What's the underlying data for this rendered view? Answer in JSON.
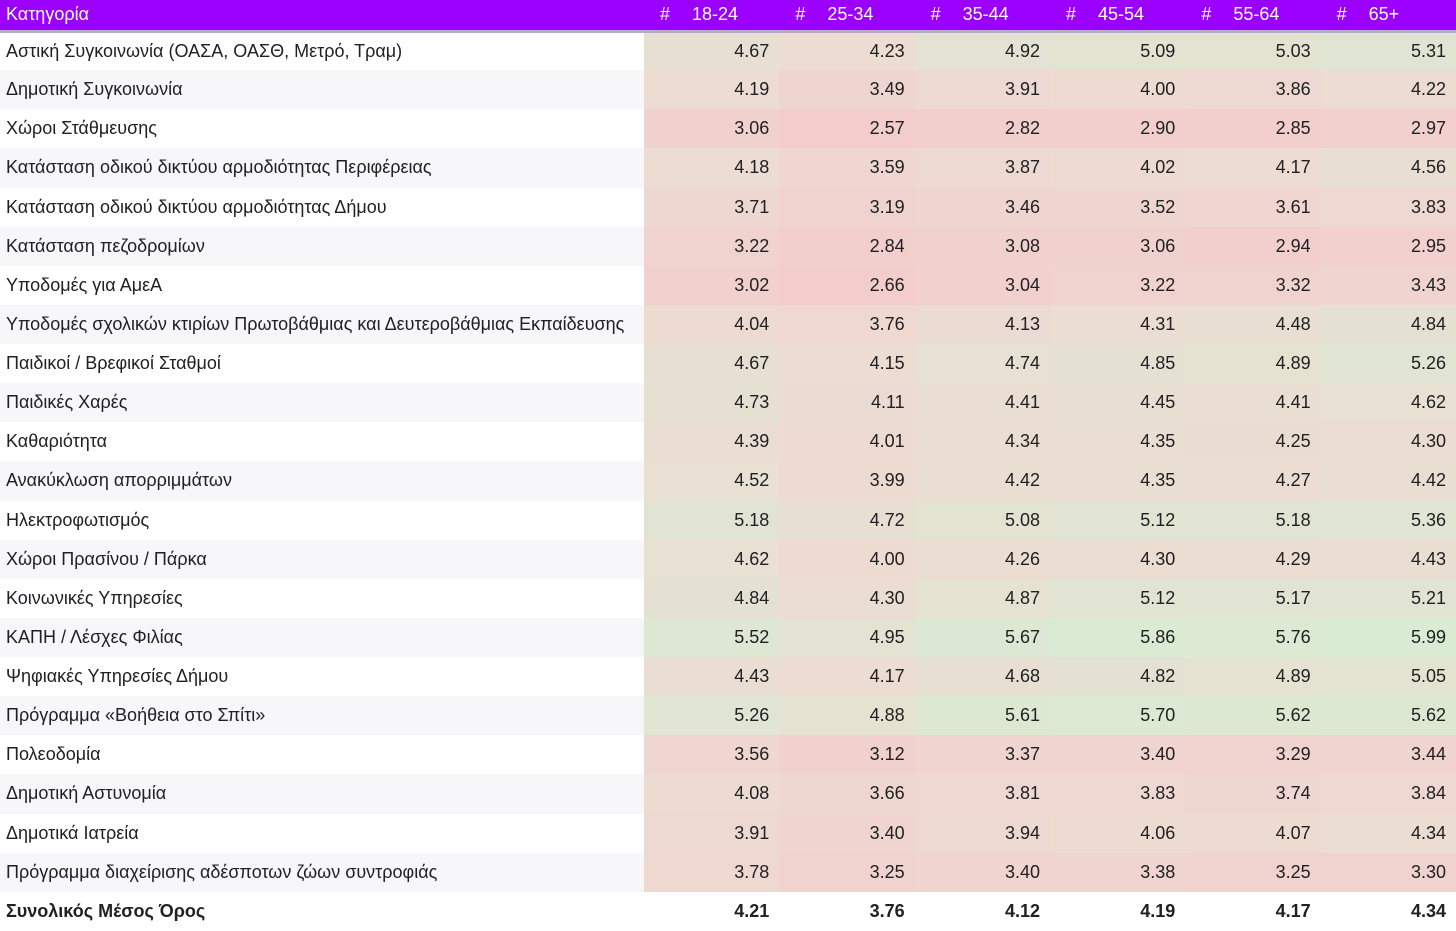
{
  "header": {
    "category_label": "Κατηγορία",
    "hash": "#",
    "age_groups": [
      "18-24",
      "25-34",
      "35-44",
      "45-54",
      "55-64",
      "65+"
    ]
  },
  "rows": [
    {
      "label": "Αστική Συγκοινωνία (ΟΑΣΑ, ΟΑΣΘ, Μετρό, Τραμ)",
      "values": [
        "4.67",
        "4.23",
        "4.92",
        "5.09",
        "5.03",
        "5.31"
      ]
    },
    {
      "label": "Δημοτική Συγκοινωνία",
      "values": [
        "4.19",
        "3.49",
        "3.91",
        "4.00",
        "3.86",
        "4.22"
      ]
    },
    {
      "label": "Χώροι Στάθμευσης",
      "values": [
        "3.06",
        "2.57",
        "2.82",
        "2.90",
        "2.85",
        "2.97"
      ]
    },
    {
      "label": "Κατάσταση οδικού δικτύου αρμοδιότητας Περιφέρειας",
      "values": [
        "4.18",
        "3.59",
        "3.87",
        "4.02",
        "4.17",
        "4.56"
      ]
    },
    {
      "label": "Κατάσταση οδικού δικτύου αρμοδιότητας Δήμου",
      "values": [
        "3.71",
        "3.19",
        "3.46",
        "3.52",
        "3.61",
        "3.83"
      ]
    },
    {
      "label": "Κατάσταση πεζοδρομίων",
      "values": [
        "3.22",
        "2.84",
        "3.08",
        "3.06",
        "2.94",
        "2.95"
      ]
    },
    {
      "label": "Υποδομές για ΑμεΑ",
      "values": [
        "3.02",
        "2.66",
        "3.04",
        "3.22",
        "3.32",
        "3.43"
      ]
    },
    {
      "label": "Υποδομές σχολικών κτιρίων Πρωτοβάθμιας και Δευτεροβάθμιας Εκπαίδευσης",
      "values": [
        "4.04",
        "3.76",
        "4.13",
        "4.31",
        "4.48",
        "4.84"
      ]
    },
    {
      "label": "Παιδικοί / Βρεφικοί Σταθμοί",
      "values": [
        "4.67",
        "4.15",
        "4.74",
        "4.85",
        "4.89",
        "5.26"
      ]
    },
    {
      "label": "Παιδικές Χαρές",
      "values": [
        "4.73",
        "4.11",
        "4.41",
        "4.45",
        "4.41",
        "4.62"
      ]
    },
    {
      "label": "Καθαριότητα",
      "values": [
        "4.39",
        "4.01",
        "4.34",
        "4.35",
        "4.25",
        "4.30"
      ]
    },
    {
      "label": "Ανακύκλωση απορριμμάτων",
      "values": [
        "4.52",
        "3.99",
        "4.42",
        "4.35",
        "4.27",
        "4.42"
      ]
    },
    {
      "label": "Ηλεκτροφωτισμός",
      "values": [
        "5.18",
        "4.72",
        "5.08",
        "5.12",
        "5.18",
        "5.36"
      ]
    },
    {
      "label": "Χώροι Πρασίνου / Πάρκα",
      "values": [
        "4.62",
        "4.00",
        "4.26",
        "4.30",
        "4.29",
        "4.43"
      ]
    },
    {
      "label": "Κοινωνικές Υπηρεσίες",
      "values": [
        "4.84",
        "4.30",
        "4.87",
        "5.12",
        "5.17",
        "5.21"
      ]
    },
    {
      "label": "ΚΑΠΗ / Λέσχες Φιλίας",
      "values": [
        "5.52",
        "4.95",
        "5.67",
        "5.86",
        "5.76",
        "5.99"
      ]
    },
    {
      "label": "Ψηφιακές Υπηρεσίες Δήμου",
      "values": [
        "4.43",
        "4.17",
        "4.68",
        "4.82",
        "4.89",
        "5.05"
      ]
    },
    {
      "label": "Πρόγραμμα «Βοήθεια στο Σπίτι»",
      "values": [
        "5.26",
        "4.88",
        "5.61",
        "5.70",
        "5.62",
        "5.62"
      ]
    },
    {
      "label": "Πολεοδομία",
      "values": [
        "3.56",
        "3.12",
        "3.37",
        "3.40",
        "3.29",
        "3.44"
      ]
    },
    {
      "label": "Δημοτική Αστυνομία",
      "values": [
        "4.08",
        "3.66",
        "3.81",
        "3.83",
        "3.74",
        "3.84"
      ]
    },
    {
      "label": "Δημοτικά Ιατρεία",
      "values": [
        "3.91",
        "3.40",
        "3.94",
        "4.06",
        "4.07",
        "4.34"
      ]
    },
    {
      "label": "Πρόγραμμα διαχείρισης αδέσποτων ζώων συντροφιάς",
      "values": [
        "3.78",
        "3.25",
        "3.40",
        "3.38",
        "3.25",
        "3.30"
      ]
    }
  ],
  "total": {
    "label": "Συνολικός Μέσος Όρος",
    "values": [
      "4.21",
      "3.76",
      "4.12",
      "4.19",
      "4.17",
      "4.34"
    ]
  },
  "colors": {
    "header_bg": "#9b00ff",
    "low": "#f3cccc",
    "mid": "#ecdcd2",
    "high": "#d9ebd3"
  }
}
